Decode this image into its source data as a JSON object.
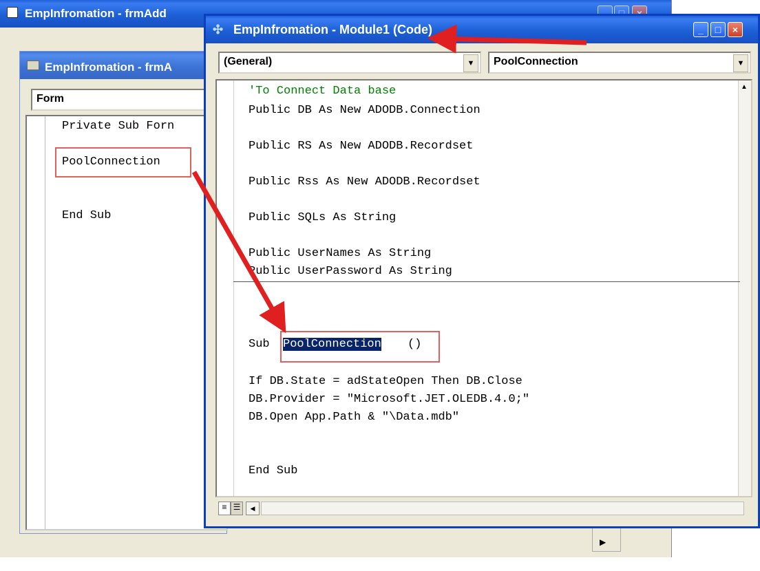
{
  "back_window": {
    "title": "EmpInfromation - frmAdd",
    "inner_title": "EmpInfromation - frmA",
    "object_dropdown": "Form",
    "code_lines": [
      "Private Sub Forn",
      "PoolConnection",
      "End Sub"
    ]
  },
  "main_window": {
    "title": "EmpInfromation - Module1 (Code)",
    "object_dropdown": "(General)",
    "procedure_dropdown": "PoolConnection",
    "code": {
      "comment": "'To Connect Data base",
      "declarations": [
        "Public DB As New ADODB.Connection",
        "Public RS As New ADODB.Recordset",
        "Public Rss As New ADODB.Recordset",
        "Public SQLs As String",
        "Public UserNames As String",
        "Public UserPassword As String"
      ],
      "sub_keyword": "Sub ",
      "sub_name": "PoolConnection",
      "sub_parens": "()",
      "body": [
        "If DB.State = adStateOpen Then DB.Close",
        "DB.Provider = \"Microsoft.JET.OLEDB.4.0;\"",
        "DB.Open App.Path & \"\\Data.mdb\""
      ],
      "end": "End Sub"
    }
  },
  "colors": {
    "arrow": "#e02020",
    "highlight_box": "#e06060",
    "selection": "#0a246a",
    "comment": "#008000"
  },
  "icons": [
    "form-icon",
    "module-icon",
    "minimize-icon",
    "maximize-icon",
    "close-icon",
    "dropdown-arrow-icon",
    "procedure-view-icon",
    "full-module-view-icon",
    "scroll-left-icon",
    "scroll-up-icon"
  ]
}
